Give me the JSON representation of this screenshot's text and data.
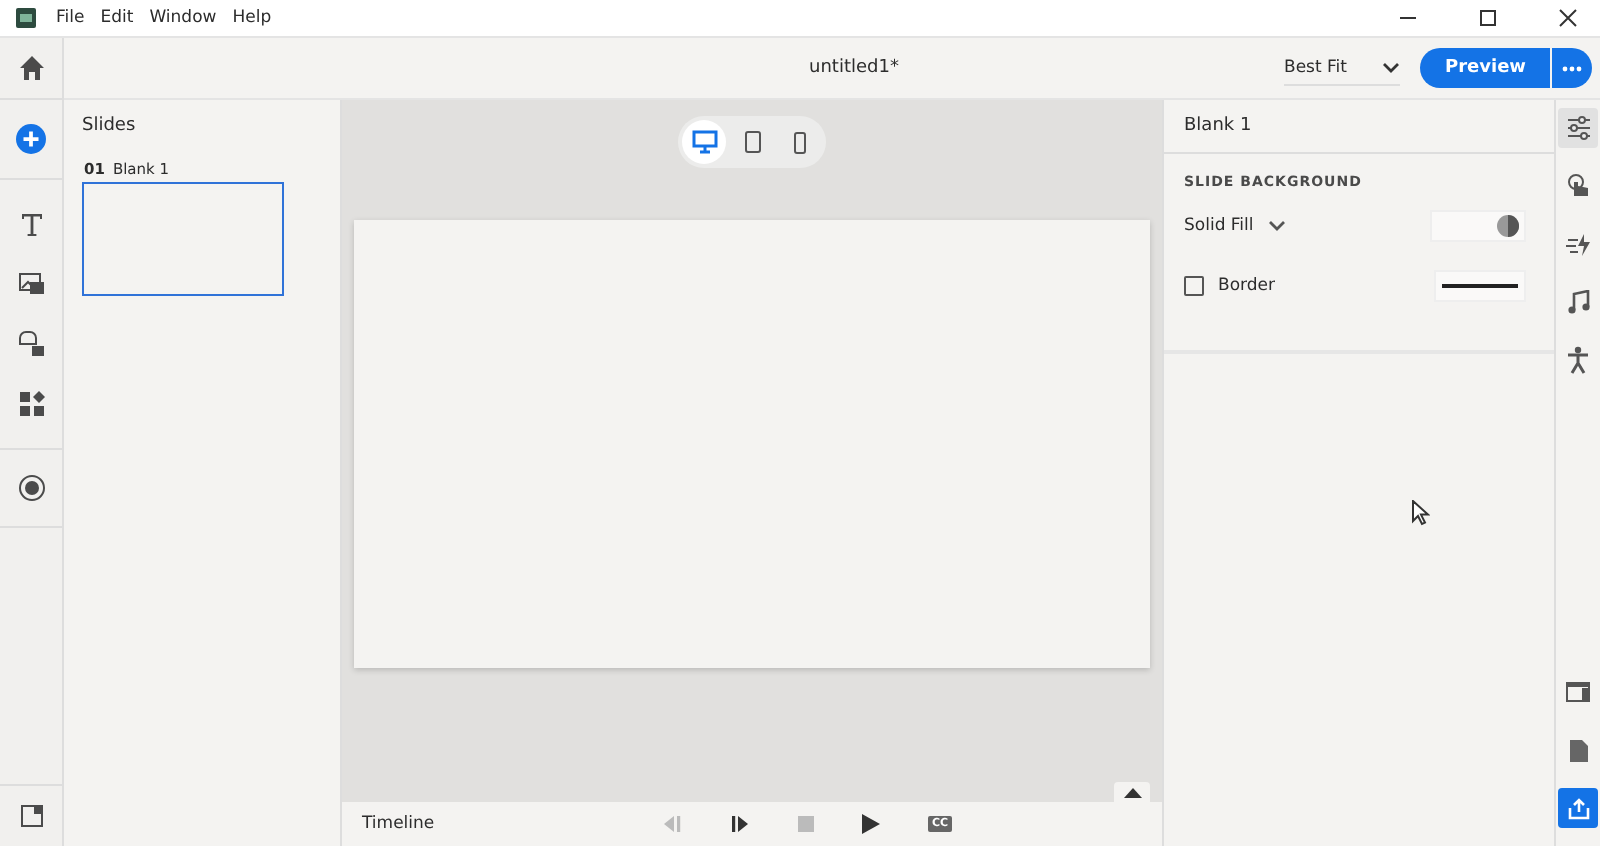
{
  "menu": [
    "File",
    "Edit",
    "Window",
    "Help"
  ],
  "title": "untitled1*",
  "zoom": {
    "value": "Best Fit"
  },
  "preview_button": "Preview",
  "devices": [
    {
      "selected": true
    },
    {
      "selected": false
    },
    {
      "selected": false
    }
  ],
  "slides_panel": {
    "title": "Slides",
    "slides": [
      {
        "number": "01",
        "name": "Blank 1",
        "selected": true
      }
    ]
  },
  "properties": {
    "title": "Blank 1",
    "section": "SLIDE BACKGROUND",
    "fill": "Solid Fill",
    "border": {
      "label": "Border",
      "checked": false
    }
  },
  "right_rail": [
    {
      "selected": true
    },
    {
      "selected": false
    },
    {
      "selected": false
    },
    {
      "selected": false
    },
    {
      "selected": false
    }
  ],
  "timeline": {
    "label": "Timeline",
    "controls": [
      {
        "disabled": true
      },
      {
        "disabled": false
      },
      {
        "disabled": true
      },
      {
        "disabled": false
      }
    ],
    "cc": "CC"
  }
}
